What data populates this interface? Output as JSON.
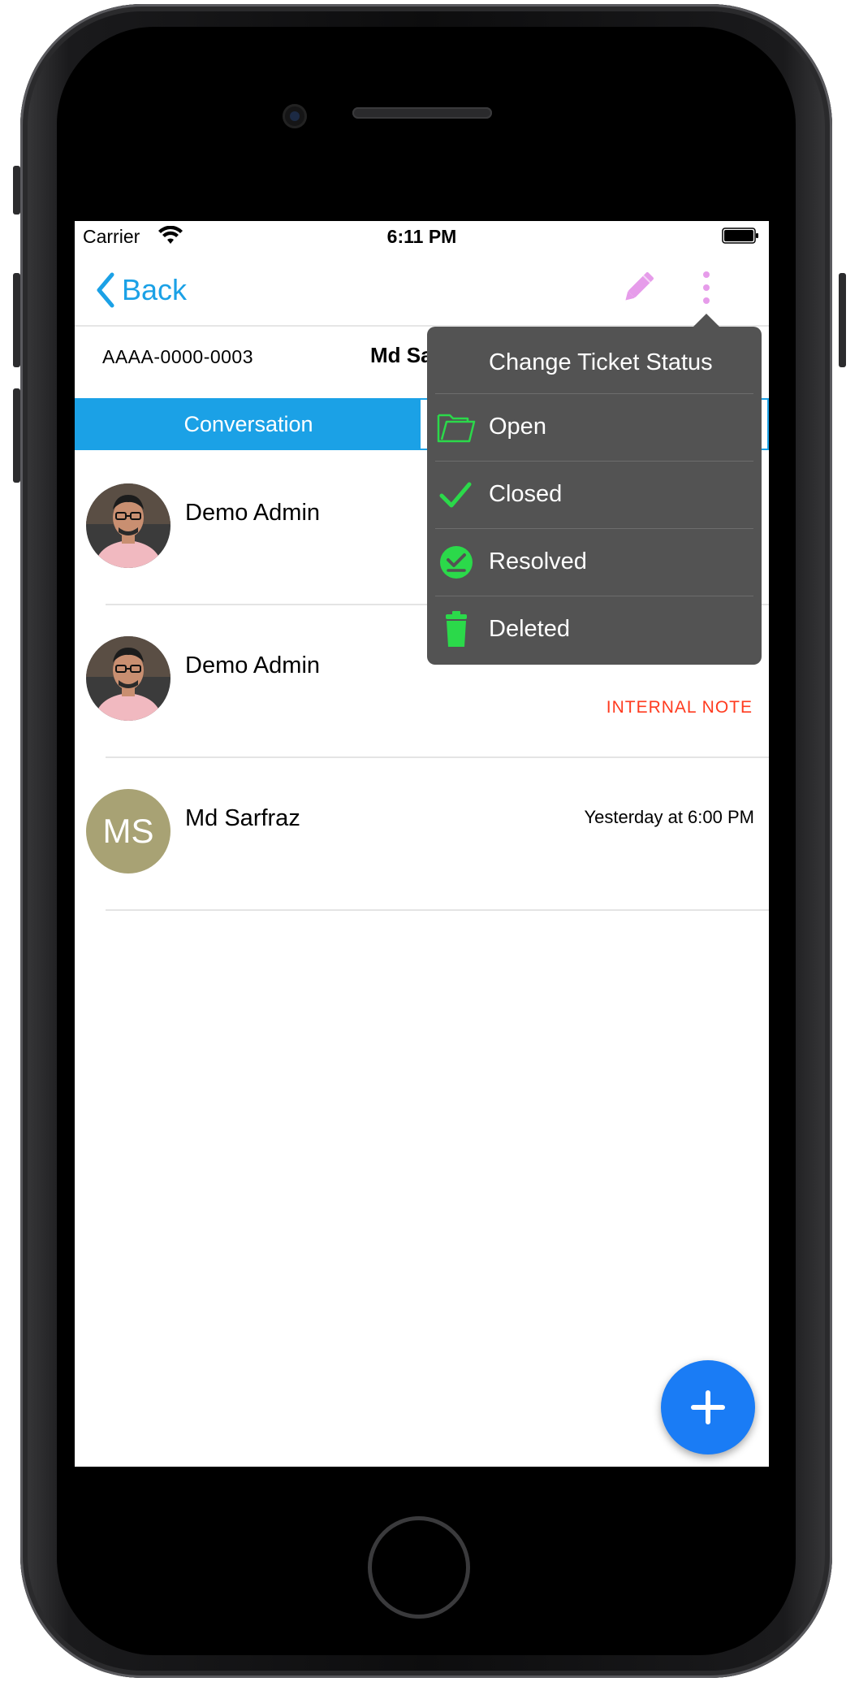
{
  "status_bar": {
    "carrier": "Carrier",
    "time": "6:11 PM"
  },
  "nav": {
    "back_label": "Back",
    "edit_icon": "pencil-icon",
    "more_icon": "more-vertical-icon",
    "accent_color": "#1ba1e6"
  },
  "ticket": {
    "id": "AAAA-0000-0003",
    "requester": "Md Sa"
  },
  "tabs": [
    {
      "label": "Conversation",
      "selected": true
    }
  ],
  "threads": [
    {
      "name": "Demo Admin",
      "time": "",
      "note": ""
    },
    {
      "name": "Demo Admin",
      "time": "",
      "note": "INTERNAL NOTE"
    },
    {
      "name": "Md Sarfraz",
      "initials": "MS",
      "time": "Yesterday at 6:00 PM",
      "note": ""
    }
  ],
  "status_menu": {
    "title": "Change Ticket Status",
    "items": [
      {
        "label": "Open",
        "icon": "folder-open-icon"
      },
      {
        "label": "Closed",
        "icon": "checkmark-icon"
      },
      {
        "label": "Resolved",
        "icon": "check-circle-icon"
      },
      {
        "label": "Deleted",
        "icon": "trash-icon"
      }
    ],
    "icon_color": "#2bd94a",
    "background": "#535353"
  },
  "fab": {
    "icon": "plus-icon",
    "color": "#1a7cf5"
  }
}
